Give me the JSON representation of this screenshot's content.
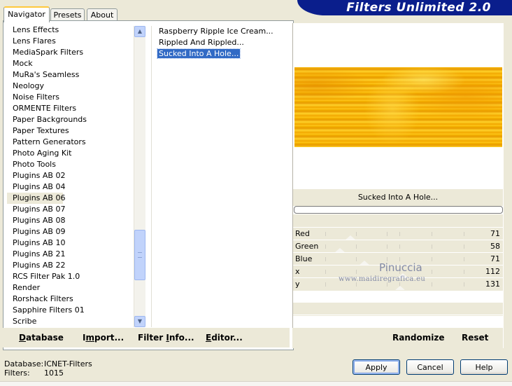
{
  "app": {
    "title": "Filters Unlimited 2.0"
  },
  "tabs": [
    {
      "label": "Navigator"
    },
    {
      "label": "Presets"
    },
    {
      "label": "About"
    }
  ],
  "categories": {
    "items": [
      "Lens Effects",
      "Lens Flares",
      "MediaSpark Filters",
      "Mock",
      "MuRa's Seamless",
      "Neology",
      "Noise Filters",
      "ORMENTE Filters",
      "Paper Backgrounds",
      "Paper Textures",
      "Pattern Generators",
      "Photo Aging Kit",
      "Photo Tools",
      "Plugins AB 02",
      "Plugins AB 04",
      "Plugins AB 06",
      "Plugins AB 07",
      "Plugins AB 08",
      "Plugins AB 09",
      "Plugins AB 10",
      "Plugins AB 21",
      "Plugins AB 22",
      "RCS Filter Pak 1.0",
      "Render",
      "Rorshack Filters",
      "Sapphire Filters 01",
      "Scribe"
    ],
    "selected": "Plugins AB 06"
  },
  "filters": {
    "items": [
      "Raspberry Ripple Ice Cream...",
      "Rippled And Rippled...",
      "Sucked Into A Hole..."
    ],
    "selected": "Sucked Into A Hole..."
  },
  "left_buttons": {
    "database": {
      "u": "D",
      "rest": "atabase"
    },
    "import": {
      "pre": "I",
      "u": "m",
      "rest": "port..."
    },
    "filter_info": {
      "pre": "Filter ",
      "u": "I",
      "rest": "nfo..."
    },
    "editor": {
      "u": "E",
      "rest": "ditor..."
    }
  },
  "preview": {
    "filter_name": "Sucked Into A Hole..."
  },
  "params": [
    {
      "label": "Red",
      "value": "71"
    },
    {
      "label": "Green",
      "value": "58"
    },
    {
      "label": "Blue",
      "value": "71"
    },
    {
      "label": "x",
      "value": "112"
    },
    {
      "label": "y",
      "value": "131"
    }
  ],
  "right_buttons": {
    "randomize": "Randomize",
    "reset": "Reset"
  },
  "watermark": {
    "name": "Pinuccia",
    "site": "www.maidiregrafica.eu"
  },
  "status": {
    "database_label": "Database:",
    "database_value": "ICNET-Filters",
    "filters_label": "Filters:",
    "filters_value": "1015"
  },
  "dialog_buttons": {
    "apply": "Apply",
    "cancel": "Cancel",
    "help": "Help"
  }
}
